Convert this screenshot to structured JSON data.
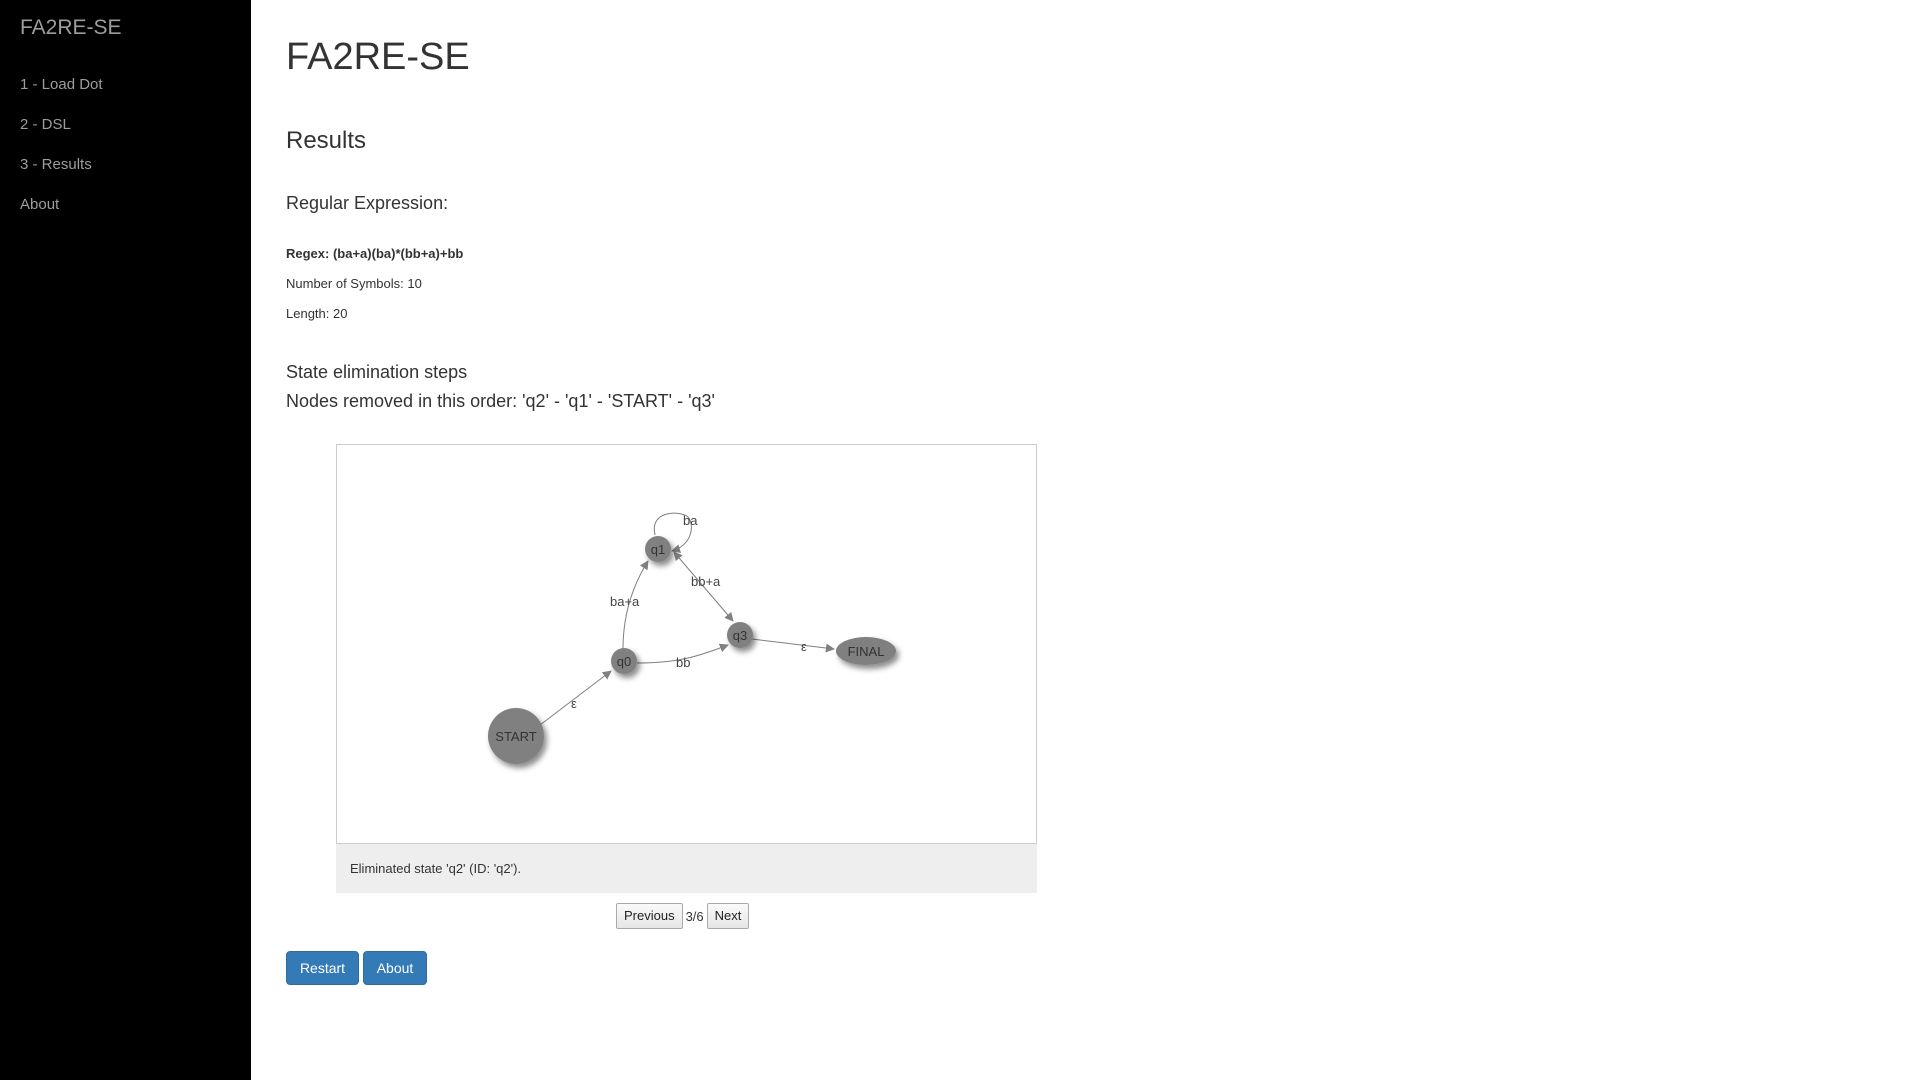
{
  "app": {
    "brand": "FA2RE-SE",
    "nav": [
      {
        "label": "1 - Load Dot"
      },
      {
        "label": "2 - DSL"
      },
      {
        "label": "3 - Results"
      },
      {
        "label": "About"
      }
    ]
  },
  "main": {
    "title": "FA2RE-SE",
    "section": "Results",
    "subsection": "Regular Expression:",
    "regex_label": "Regex: (ba+a)(ba)*(bb+a)+bb",
    "num_symbols": "Number of Symbols: 10",
    "length": "Length: 20",
    "steps_title": "State elimination steps",
    "steps_order": "Nodes removed in this order: 'q2' - 'q1' - 'START' - 'q3'"
  },
  "graph": {
    "nodes": {
      "q1": "q1",
      "q0": "q0",
      "q3": "q3",
      "start": "START",
      "final": "FINAL"
    },
    "edges": {
      "q1_loop": "ba",
      "q1_q3": "bb+a",
      "q0_q1": "ba+a",
      "q0_q3": "bb",
      "q3_final": "ε",
      "start_q0": "ε"
    },
    "node_color": "#808080"
  },
  "caption": "Eliminated state 'q2' (ID: 'q2').",
  "pager": {
    "previous": "Previous",
    "indicator": "3/6",
    "next": "Next"
  },
  "buttons": {
    "restart": "Restart",
    "about": "About"
  },
  "colors": {
    "primary": "#337ab7",
    "sidebar_bg": "#000000"
  }
}
